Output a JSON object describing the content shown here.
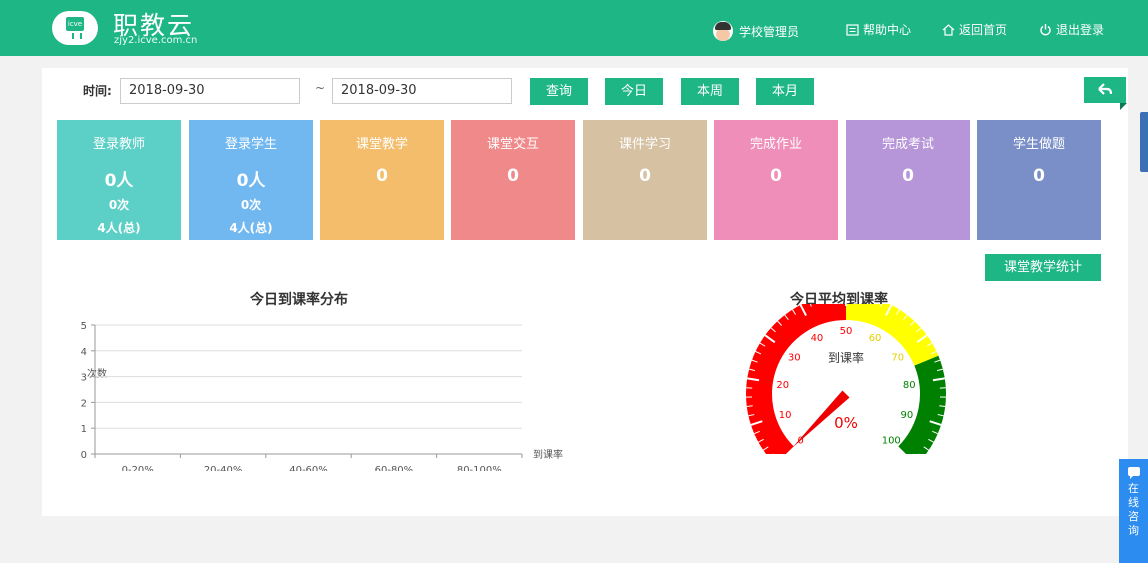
{
  "header": {
    "logo_icon_text": "icve",
    "logo_title": "职教云",
    "logo_subtitle": "zjy2.icve.com.cn",
    "nav": {
      "user": "学校管理员",
      "help": "帮助中心",
      "home": "返回首页",
      "logout": "退出登录"
    }
  },
  "filter": {
    "label": "时间:",
    "start_date": "2018-09-30",
    "separator": "~",
    "end_date": "2018-09-30",
    "buttons": {
      "query": "查询",
      "today": "今日",
      "week": "本周",
      "month": "本月"
    }
  },
  "cards": [
    {
      "title": "登录教师",
      "value": "0人",
      "count": "0次",
      "total": "4人(总)",
      "color": "#5ccfc6"
    },
    {
      "title": "登录学生",
      "value": "0人",
      "count": "0次",
      "total": "4人(总)",
      "color": "#72b8f0"
    },
    {
      "title": "课堂教学",
      "value": "0",
      "color": "#f4bd6b"
    },
    {
      "title": "课堂交互",
      "value": "0",
      "color": "#f08a8a"
    },
    {
      "title": "课件学习",
      "value": "0",
      "color": "#d6c1a2"
    },
    {
      "title": "完成作业",
      "value": "0",
      "color": "#ef8fb9"
    },
    {
      "title": "完成考试",
      "value": "0",
      "color": "#b695d8"
    },
    {
      "title": "学生做题",
      "value": "0",
      "color": "#7a8fc8"
    }
  ],
  "stat_button": "课堂教学统计",
  "chart_data": [
    {
      "type": "bar",
      "title": "今日到课率分布",
      "ylabel": "次数",
      "xlabel": "到课率",
      "categories": [
        "0-20%",
        "20-40%",
        "40-60%",
        "60-80%",
        "80-100%"
      ],
      "values": [
        0,
        0,
        0,
        0,
        0
      ],
      "ylim": [
        0,
        5
      ],
      "yticks": [
        "0",
        "1",
        "2",
        "3",
        "4",
        "5"
      ],
      "grid": true
    },
    {
      "type": "gauge",
      "title": "今日平均到课率",
      "series_name": "到课率",
      "value": 0,
      "value_label": "0%",
      "range": [
        0,
        100
      ],
      "ticks": [
        "0",
        "10",
        "20",
        "30",
        "40",
        "50",
        "60",
        "70",
        "80",
        "90",
        "100"
      ],
      "bands": [
        {
          "from": 0,
          "to": 50,
          "color": "#ff0000"
        },
        {
          "from": 50,
          "to": 75,
          "color": "#ffff00"
        },
        {
          "from": 75,
          "to": 100,
          "color": "#008000"
        }
      ]
    }
  ],
  "side": {
    "consult": "在线咨询"
  }
}
